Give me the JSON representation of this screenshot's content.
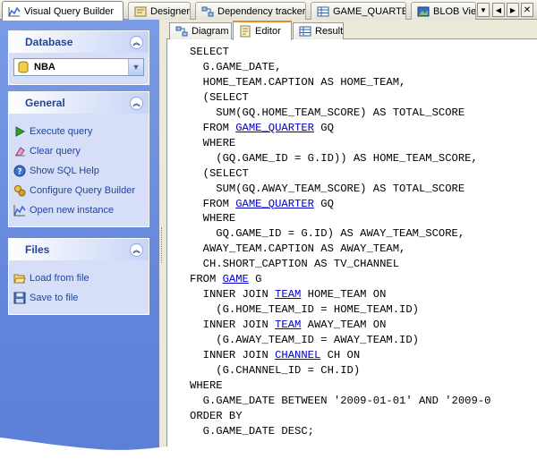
{
  "top_tabs": [
    {
      "label": "Visual Query Builder",
      "icon": "chart-line-icon",
      "active": true
    },
    {
      "label": "Designer",
      "icon": "designer-icon",
      "active": false
    },
    {
      "label": "Dependency tracker",
      "icon": "dependency-icon",
      "active": false
    },
    {
      "label": "GAME_QUARTER",
      "icon": "table-icon",
      "active": false
    },
    {
      "label": "BLOB View",
      "icon": "blob-icon",
      "active": false
    }
  ],
  "sidebar": {
    "database": {
      "title": "Database",
      "selected": "NBA"
    },
    "general": {
      "title": "General",
      "items": [
        {
          "label": "Execute query",
          "icon": "play-icon"
        },
        {
          "label": "Clear query",
          "icon": "clear-icon"
        },
        {
          "label": "Show SQL Help",
          "icon": "help-icon"
        },
        {
          "label": "Configure Query Builder",
          "icon": "configure-icon"
        },
        {
          "label": "Open new instance",
          "icon": "new-instance-icon"
        }
      ]
    },
    "files": {
      "title": "Files",
      "items": [
        {
          "label": "Load from file",
          "icon": "folder-open-icon"
        },
        {
          "label": "Save to file",
          "icon": "floppy-icon"
        }
      ]
    }
  },
  "editor_tabs": [
    {
      "label": "Diagram",
      "icon": "diagram-icon",
      "active": false
    },
    {
      "label": "Editor",
      "icon": "editor-icon",
      "active": true
    },
    {
      "label": "Result",
      "icon": "result-icon",
      "active": false
    }
  ],
  "sql_lines": [
    [
      {
        "t": "SELECT"
      }
    ],
    [
      {
        "t": "  G.GAME_DATE,"
      }
    ],
    [
      {
        "t": "  HOME_TEAM.CAPTION AS HOME_TEAM,"
      }
    ],
    [
      {
        "t": "  (SELECT"
      }
    ],
    [
      {
        "t": "    SUM(GQ.HOME_TEAM_SCORE) AS TOTAL_SCORE"
      }
    ],
    [
      {
        "t": "  FROM "
      },
      {
        "t": "GAME_QUARTER",
        "link": true
      },
      {
        "t": " GQ"
      }
    ],
    [
      {
        "t": "  WHERE"
      }
    ],
    [
      {
        "t": "    (GQ.GAME_ID = G.ID)) AS HOME_TEAM_SCORE,"
      }
    ],
    [
      {
        "t": "  (SELECT"
      }
    ],
    [
      {
        "t": "    SUM(GQ.AWAY_TEAM_SCORE) AS TOTAL_SCORE"
      }
    ],
    [
      {
        "t": "  FROM "
      },
      {
        "t": "GAME_QUARTER",
        "link": true
      },
      {
        "t": " GQ"
      }
    ],
    [
      {
        "t": "  WHERE"
      }
    ],
    [
      {
        "t": "    GQ.GAME_ID = G.ID) AS AWAY_TEAM_SCORE,"
      }
    ],
    [
      {
        "t": "  AWAY_TEAM.CAPTION AS AWAY_TEAM,"
      }
    ],
    [
      {
        "t": "  CH.SHORT_CAPTION AS TV_CHANNEL"
      }
    ],
    [
      {
        "t": "FROM "
      },
      {
        "t": "GAME",
        "link": true
      },
      {
        "t": " G"
      }
    ],
    [
      {
        "t": "  INNER JOIN "
      },
      {
        "t": "TEAM",
        "link": true
      },
      {
        "t": " HOME_TEAM ON"
      }
    ],
    [
      {
        "t": "    (G.HOME_TEAM_ID = HOME_TEAM.ID)"
      }
    ],
    [
      {
        "t": "  INNER JOIN "
      },
      {
        "t": "TEAM",
        "link": true
      },
      {
        "t": " AWAY_TEAM ON"
      }
    ],
    [
      {
        "t": "    (G.AWAY_TEAM_ID = AWAY_TEAM.ID)"
      }
    ],
    [
      {
        "t": "  INNER JOIN "
      },
      {
        "t": "CHANNEL",
        "link": true
      },
      {
        "t": " CH ON"
      }
    ],
    [
      {
        "t": "    (G.CHANNEL_ID = CH.ID)"
      }
    ],
    [
      {
        "t": "WHERE"
      }
    ],
    [
      {
        "t": "  G.GAME_DATE BETWEEN '2009-01-01' AND '2009-0"
      }
    ],
    [
      {
        "t": "ORDER BY"
      }
    ],
    [
      {
        "t": "  G.GAME_DATE DESC;"
      }
    ]
  ],
  "colors": {
    "panel_blue": "#6487dc",
    "group_bg": "#d6dff7",
    "group_title": "#21469c",
    "link_blue": "#0000cc",
    "active_tab_accent": "#e68b2c"
  }
}
